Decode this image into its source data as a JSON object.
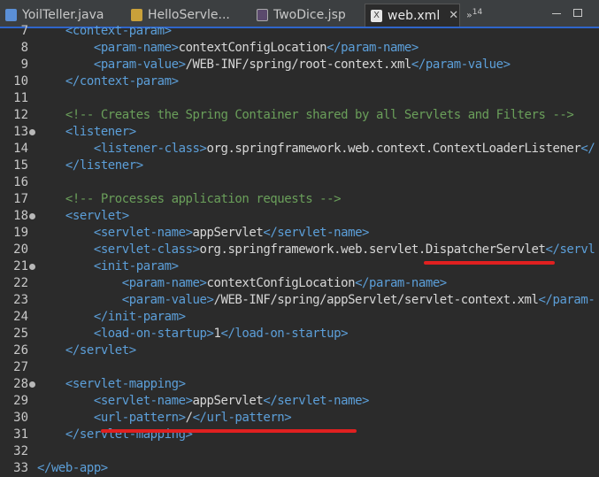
{
  "tabs": [
    {
      "label": "YoilTeller.java",
      "icon": "java-file-icon",
      "active": false
    },
    {
      "label": "HelloServle...",
      "icon": "servlet-file-icon",
      "active": false
    },
    {
      "label": "TwoDice.jsp",
      "icon": "jsp-file-icon",
      "active": false
    },
    {
      "label": "web.xml",
      "icon": "xml-file-icon",
      "active": true,
      "close": "✕"
    }
  ],
  "overflow": {
    "label": "»",
    "count": "14"
  },
  "colors": {
    "tag": "#5c9fd9",
    "comment": "#6a9f5a",
    "text": "#d7d7d7",
    "annotation": "#e02020"
  },
  "lines": [
    {
      "n": "7",
      "fold": false,
      "indent": 1,
      "parts": [
        [
          "tag",
          "<context-param>"
        ]
      ]
    },
    {
      "n": "8",
      "fold": false,
      "indent": 2,
      "parts": [
        [
          "tag",
          "<param-name>"
        ],
        [
          "txt",
          "contextConfigLocation"
        ],
        [
          "tag",
          "</param-name>"
        ]
      ]
    },
    {
      "n": "9",
      "fold": false,
      "indent": 2,
      "parts": [
        [
          "tag",
          "<param-value>"
        ],
        [
          "txt",
          "/WEB-INF/spring/root-context.xml"
        ],
        [
          "tag",
          "</param-value>"
        ]
      ]
    },
    {
      "n": "10",
      "fold": false,
      "indent": 1,
      "parts": [
        [
          "tag",
          "</context-param>"
        ]
      ]
    },
    {
      "n": "11",
      "fold": false,
      "indent": 0,
      "parts": []
    },
    {
      "n": "12",
      "fold": false,
      "indent": 1,
      "parts": [
        [
          "cmt",
          "<!-- Creates the Spring Container shared by all Servlets and Filters -->"
        ]
      ]
    },
    {
      "n": "13",
      "fold": true,
      "indent": 1,
      "parts": [
        [
          "tag",
          "<listener>"
        ]
      ]
    },
    {
      "n": "14",
      "fold": false,
      "indent": 2,
      "parts": [
        [
          "tag",
          "<listener-class>"
        ],
        [
          "txt",
          "org.springframework.web.context.ContextLoaderListener"
        ],
        [
          "tag",
          "</"
        ]
      ]
    },
    {
      "n": "15",
      "fold": false,
      "indent": 1,
      "parts": [
        [
          "tag",
          "</listener>"
        ]
      ]
    },
    {
      "n": "16",
      "fold": false,
      "indent": 0,
      "parts": []
    },
    {
      "n": "17",
      "fold": false,
      "indent": 1,
      "parts": [
        [
          "cmt",
          "<!-- Processes application requests -->"
        ]
      ]
    },
    {
      "n": "18",
      "fold": true,
      "indent": 1,
      "parts": [
        [
          "tag",
          "<servlet>"
        ]
      ]
    },
    {
      "n": "19",
      "fold": false,
      "indent": 2,
      "parts": [
        [
          "tag",
          "<servlet-name>"
        ],
        [
          "txt",
          "appServlet"
        ],
        [
          "tag",
          "</servlet-name>"
        ]
      ]
    },
    {
      "n": "20",
      "fold": false,
      "indent": 2,
      "parts": [
        [
          "tag",
          "<servlet-class>"
        ],
        [
          "txt",
          "org.springframework.web.servlet.DispatcherServlet"
        ],
        [
          "tag",
          "</servl"
        ]
      ]
    },
    {
      "n": "21",
      "fold": true,
      "indent": 2,
      "parts": [
        [
          "tag",
          "<init-param>"
        ]
      ]
    },
    {
      "n": "22",
      "fold": false,
      "indent": 3,
      "parts": [
        [
          "tag",
          "<param-name>"
        ],
        [
          "txt",
          "contextConfigLocation"
        ],
        [
          "tag",
          "</param-name>"
        ]
      ]
    },
    {
      "n": "23",
      "fold": false,
      "indent": 3,
      "parts": [
        [
          "tag",
          "<param-value>"
        ],
        [
          "txt",
          "/WEB-INF/spring/appServlet/servlet-context.xml"
        ],
        [
          "tag",
          "</param-"
        ]
      ]
    },
    {
      "n": "24",
      "fold": false,
      "indent": 2,
      "parts": [
        [
          "tag",
          "</init-param>"
        ]
      ]
    },
    {
      "n": "25",
      "fold": false,
      "indent": 2,
      "parts": [
        [
          "tag",
          "<load-on-startup>"
        ],
        [
          "txt",
          "1"
        ],
        [
          "tag",
          "</load-on-startup>"
        ]
      ]
    },
    {
      "n": "26",
      "fold": false,
      "indent": 1,
      "parts": [
        [
          "tag",
          "</servlet>"
        ]
      ]
    },
    {
      "n": "27",
      "fold": false,
      "indent": 0,
      "parts": []
    },
    {
      "n": "28",
      "fold": true,
      "indent": 1,
      "parts": [
        [
          "tag",
          "<servlet-mapping>"
        ]
      ]
    },
    {
      "n": "29",
      "fold": false,
      "indent": 2,
      "parts": [
        [
          "tag",
          "<servlet-name>"
        ],
        [
          "txt",
          "appServlet"
        ],
        [
          "tag",
          "</servlet-name>"
        ]
      ]
    },
    {
      "n": "30",
      "fold": false,
      "indent": 2,
      "parts": [
        [
          "tag",
          "<url-pattern>"
        ],
        [
          "txt",
          "/"
        ],
        [
          "tag",
          "</url-pattern>"
        ]
      ]
    },
    {
      "n": "31",
      "fold": false,
      "indent": 1,
      "parts": [
        [
          "tag",
          "</servlet-mapping>"
        ]
      ]
    },
    {
      "n": "32",
      "fold": false,
      "indent": 0,
      "parts": []
    },
    {
      "n": "33",
      "fold": false,
      "indent": 0,
      "parts": [
        [
          "tag",
          "</web-app>"
        ]
      ]
    }
  ]
}
